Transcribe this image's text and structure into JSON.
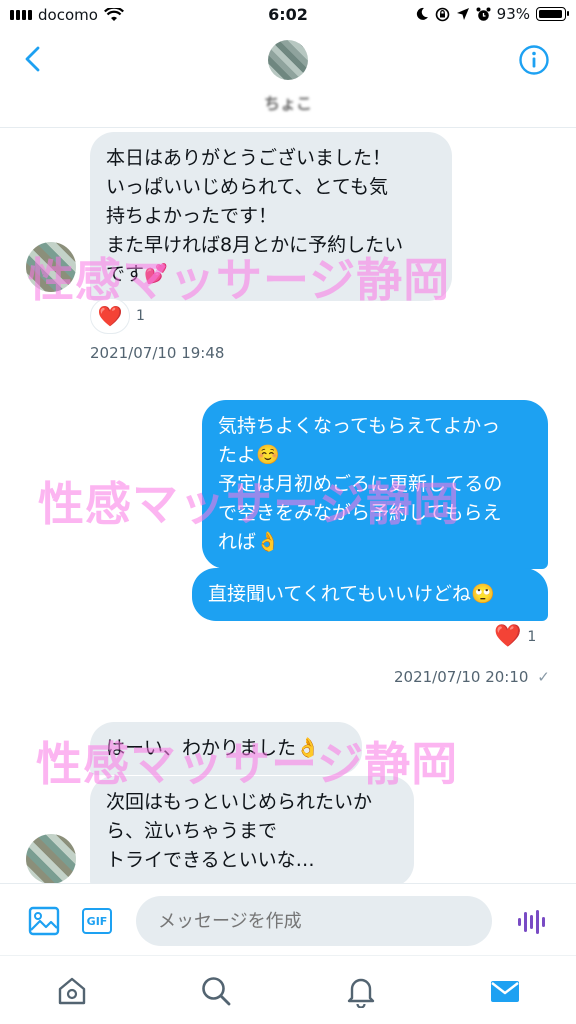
{
  "status_bar": {
    "carrier": "docomo",
    "time": "6:02",
    "battery": "93%"
  },
  "header": {
    "name": "ちょこ",
    "back_icon": "chevron-left-icon",
    "info_icon": "info-icon"
  },
  "messages": [
    {
      "direction": "in",
      "text": "本日はありがとうございました！\nいっぱいいじめられて、とても気\n持ちよかったです！\nまた早ければ8月とかに予約したい\nです💕",
      "reaction": {
        "emoji": "❤️",
        "count": "1"
      },
      "timestamp": "2021/07/10 19:48"
    },
    {
      "direction": "out",
      "text": "気持ちよくなってもらえてよかっ\nたよ☺️\n予定は月初めごろに更新してるの\nで空きをみながら予約してもらえ\nれば👌"
    },
    {
      "direction": "out",
      "text": "直接聞いてくれてもいいけどね🙄",
      "reaction": {
        "emoji": "❤️",
        "count": "1"
      },
      "timestamp": "2021/07/10 20:10",
      "read_mark": "✓"
    },
    {
      "direction": "in",
      "text": "はーい、わかりました👌"
    },
    {
      "direction": "in",
      "text": "次回はもっといじめられたいか\nら、泣いちゃうまで\nトライできるといいな…"
    }
  ],
  "watermark": "性感マッサージ静岡",
  "composer": {
    "placeholder": "メッセージを作成",
    "gif_label": "GIF"
  },
  "colors": {
    "accent": "#1da1f2",
    "incoming_bubble": "#e6ecf0",
    "watermark": "#fa78e6",
    "voice": "#794bc4"
  },
  "tabs": [
    "home-icon",
    "search-icon",
    "notifications-icon",
    "messages-icon"
  ]
}
